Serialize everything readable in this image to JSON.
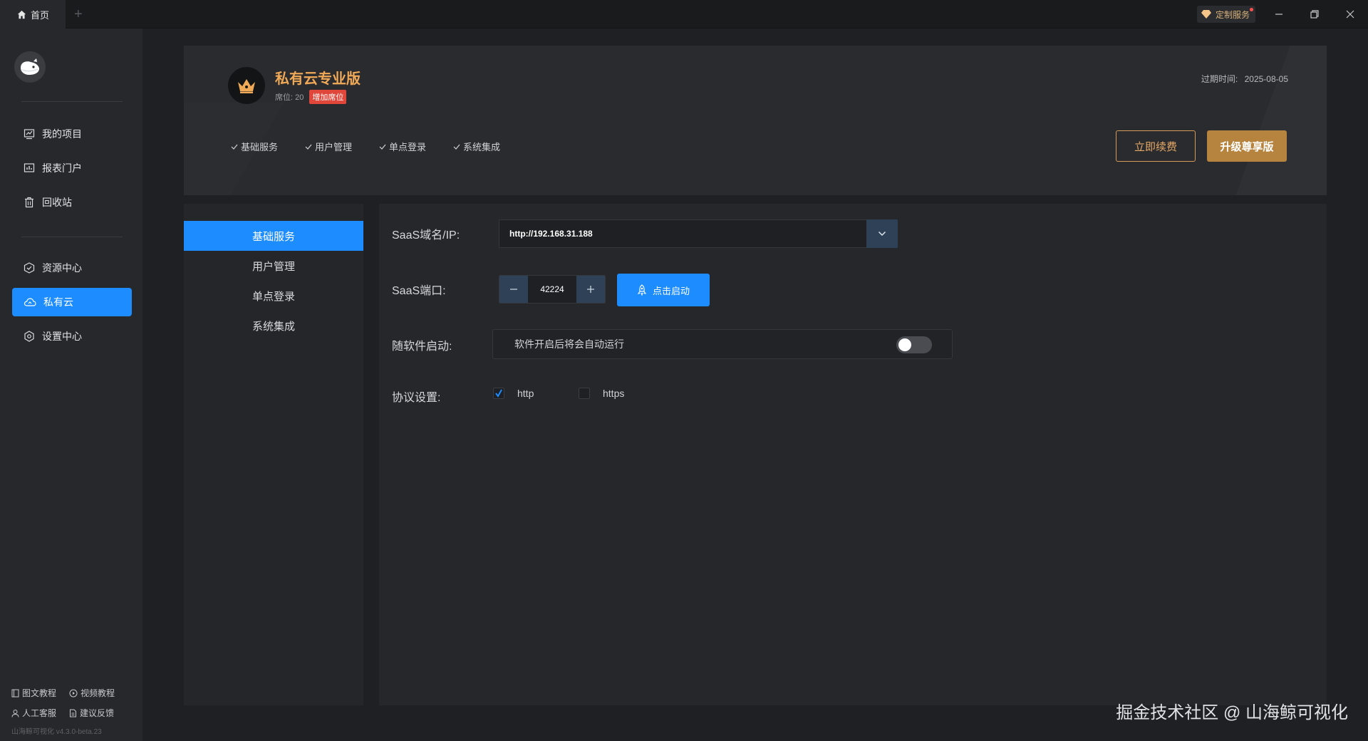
{
  "titlebar": {
    "home_tab": "首页",
    "add_tab": "+",
    "custom_service": "定制服务",
    "minimize": "—",
    "restore": "❐",
    "close": "✕"
  },
  "sidebar": {
    "items": [
      {
        "label": "我的项目",
        "icon": "project-icon"
      },
      {
        "label": "报表门户",
        "icon": "report-icon"
      },
      {
        "label": "回收站",
        "icon": "trash-icon"
      },
      {
        "label": "资源中心",
        "icon": "resource-icon"
      },
      {
        "label": "私有云",
        "icon": "cloud-icon",
        "active": true
      },
      {
        "label": "设置中心",
        "icon": "settings-icon"
      }
    ],
    "bottom_links": [
      "图文教程",
      "视频教程",
      "人工客服",
      "建议反馈"
    ],
    "version": "山海鲸可视化 v4.3.0-beta.23"
  },
  "header": {
    "plan_title": "私有云专业版",
    "seat_text": "席位: 20",
    "seat_badge": "增加席位",
    "expire_label": "过期时间:",
    "expire_date": "2025-08-05",
    "features": [
      "基础服务",
      "用户管理",
      "单点登录",
      "系统集成"
    ],
    "renew_button": "立即续费",
    "upgrade_button": "升级尊享版"
  },
  "menu": {
    "items": [
      "基础服务",
      "用户管理",
      "单点登录",
      "系统集成"
    ],
    "active_index": 0
  },
  "form": {
    "domain_label": "SaaS域名/IP:",
    "domain_value": "http://192.168.31.188",
    "port_label": "SaaS端口:",
    "port_value": "42224",
    "start_button": "点击启动",
    "autostart_label": "随软件启动:",
    "autostart_text": "软件开启后将会自动运行",
    "autostart_on": false,
    "protocol_label": "协议设置:",
    "protocols": [
      {
        "label": "http",
        "checked": true
      },
      {
        "label": "https",
        "checked": false
      }
    ]
  },
  "watermark": "掘金技术社区 @ 山海鲸可视化",
  "colors": {
    "accent": "#1c8cff",
    "gold": "#f0a957",
    "badge_red": "#e0473a"
  }
}
